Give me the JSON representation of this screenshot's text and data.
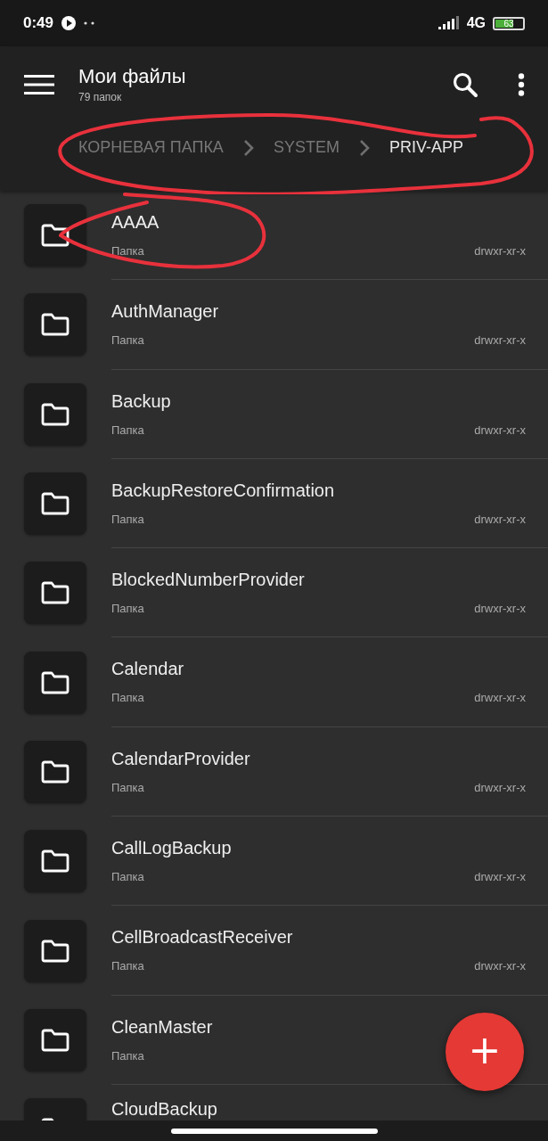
{
  "status_bar": {
    "time": "0:49",
    "network": "4G",
    "battery": "63"
  },
  "toolbar": {
    "title": "Мои файлы",
    "subtitle": "79 папок"
  },
  "breadcrumbs": [
    {
      "label": "КОРНЕВАЯ ПАПКА",
      "selected": false
    },
    {
      "label": "SYSTEM",
      "selected": false
    },
    {
      "label": "PRIV-APP",
      "selected": true
    }
  ],
  "files": [
    {
      "name": "AAAA",
      "type": "Папка",
      "permissions": "drwxr-xr-x"
    },
    {
      "name": "AuthManager",
      "type": "Папка",
      "permissions": "drwxr-xr-x"
    },
    {
      "name": "Backup",
      "type": "Папка",
      "permissions": "drwxr-xr-x"
    },
    {
      "name": "BackupRestoreConfirmation",
      "type": "Папка",
      "permissions": "drwxr-xr-x"
    },
    {
      "name": "BlockedNumberProvider",
      "type": "Папка",
      "permissions": "drwxr-xr-x"
    },
    {
      "name": "Calendar",
      "type": "Папка",
      "permissions": "drwxr-xr-x"
    },
    {
      "name": "CalendarProvider",
      "type": "Папка",
      "permissions": "drwxr-xr-x"
    },
    {
      "name": "CallLogBackup",
      "type": "Папка",
      "permissions": "drwxr-xr-x"
    },
    {
      "name": "CellBroadcastReceiver",
      "type": "Папка",
      "permissions": "drwxr-xr-x"
    },
    {
      "name": "CleanMaster",
      "type": "Папка"
    },
    {
      "name": "CloudBackup"
    }
  ],
  "fab": {
    "label": "+"
  },
  "annotation": {
    "color": "#e8313c"
  }
}
